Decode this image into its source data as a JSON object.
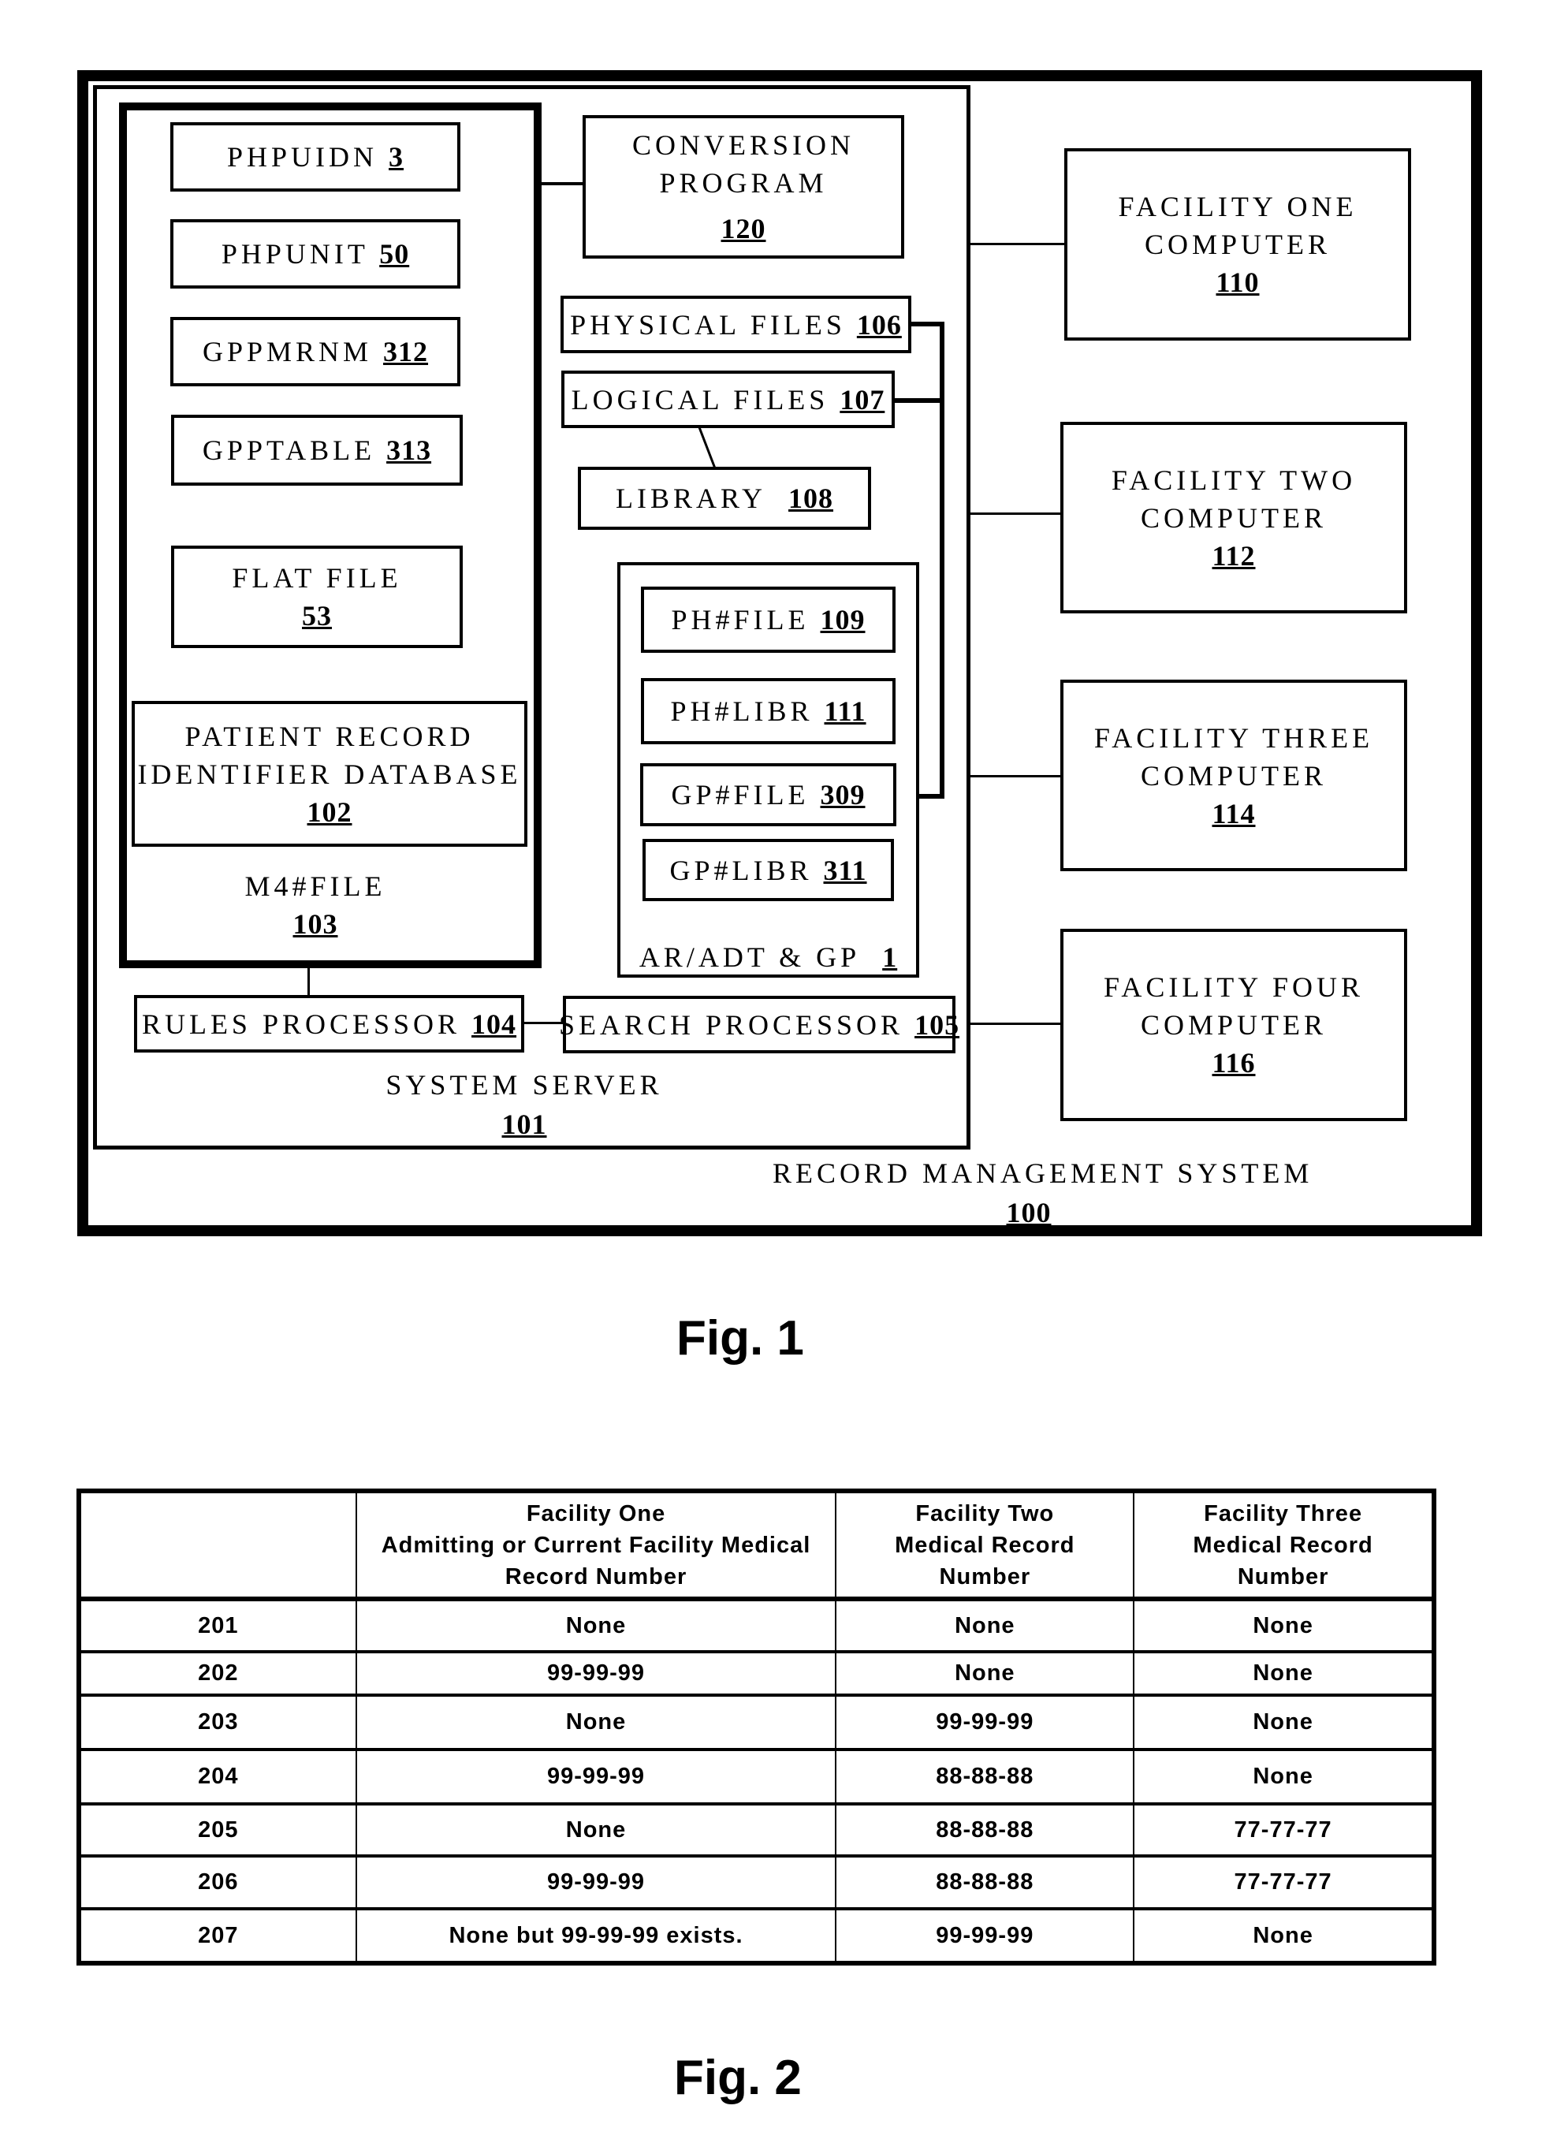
{
  "figure1": {
    "caption": "Fig.  1",
    "record_management_system": {
      "label": "RECORD MANAGEMENT SYSTEM",
      "ref": "100"
    },
    "system_server": {
      "label": "SYSTEM SERVER",
      "ref": "101"
    },
    "m4_file": {
      "label": "M4#FILE",
      "ref": "103"
    },
    "m4_items": [
      {
        "label": "PHPUIDN",
        "ref": "3"
      },
      {
        "label": "PHPUNIT",
        "ref": "50"
      },
      {
        "label": "GPPMRNM",
        "ref": "312"
      },
      {
        "label": "GPPTABLE",
        "ref": "313"
      }
    ],
    "flat_file": {
      "label": "FLAT FILE",
      "ref": "53"
    },
    "patient_db": {
      "line1": "PATIENT RECORD",
      "line2": "IDENTIFIER DATABASE",
      "ref": "102"
    },
    "conversion_program": {
      "line1": "CONVERSION",
      "line2": "PROGRAM",
      "ref": "120"
    },
    "physical_files": {
      "label": "PHYSICAL FILES",
      "ref": "106"
    },
    "logical_files": {
      "label": "LOGICAL FILES",
      "ref": "107"
    },
    "library": {
      "label": "LIBRARY",
      "ref": "108"
    },
    "ar_adt": {
      "label": "AR/ADT & GP",
      "ref": "1"
    },
    "ar_items": [
      {
        "label": "PH#FILE",
        "ref": "109"
      },
      {
        "label": "PH#LIBR",
        "ref": "111"
      },
      {
        "label": "GP#FILE",
        "ref": "309"
      },
      {
        "label": "GP#LIBR",
        "ref": "311"
      }
    ],
    "rules_processor": {
      "label": "RULES PROCESSOR",
      "ref": "104"
    },
    "search_processor": {
      "label": "SEARCH PROCESSOR",
      "ref": "105"
    },
    "facilities": [
      {
        "line1": "FACILITY ONE",
        "line2": "COMPUTER",
        "ref": "110"
      },
      {
        "line1": "FACILITY TWO",
        "line2": "COMPUTER",
        "ref": "112"
      },
      {
        "line1": "FACILITY THREE",
        "line2": "COMPUTER",
        "ref": "114"
      },
      {
        "line1": "FACILITY FOUR",
        "line2": "COMPUTER",
        "ref": "116"
      }
    ]
  },
  "figure2": {
    "caption": "Fig.  2",
    "headers": [
      {
        "lines": [
          ""
        ]
      },
      {
        "lines": [
          "Facility One",
          "Admitting or Current Facility Medical",
          "Record Number"
        ]
      },
      {
        "lines": [
          "Facility Two",
          "Medical Record",
          "Number"
        ]
      },
      {
        "lines": [
          "Facility Three",
          "Medical Record",
          "Number"
        ]
      }
    ],
    "rows": [
      [
        "201",
        "None",
        "None",
        "None"
      ],
      [
        "202",
        "99-99-99",
        "None",
        "None"
      ],
      [
        "203",
        "None",
        "99-99-99",
        "None"
      ],
      [
        "204",
        "99-99-99",
        "88-88-88",
        "None"
      ],
      [
        "205",
        "None",
        "88-88-88",
        "77-77-77"
      ],
      [
        "206",
        "99-99-99",
        "88-88-88",
        "77-77-77"
      ],
      [
        "207",
        "None but 99-99-99 exists.",
        "99-99-99",
        "None"
      ]
    ]
  }
}
